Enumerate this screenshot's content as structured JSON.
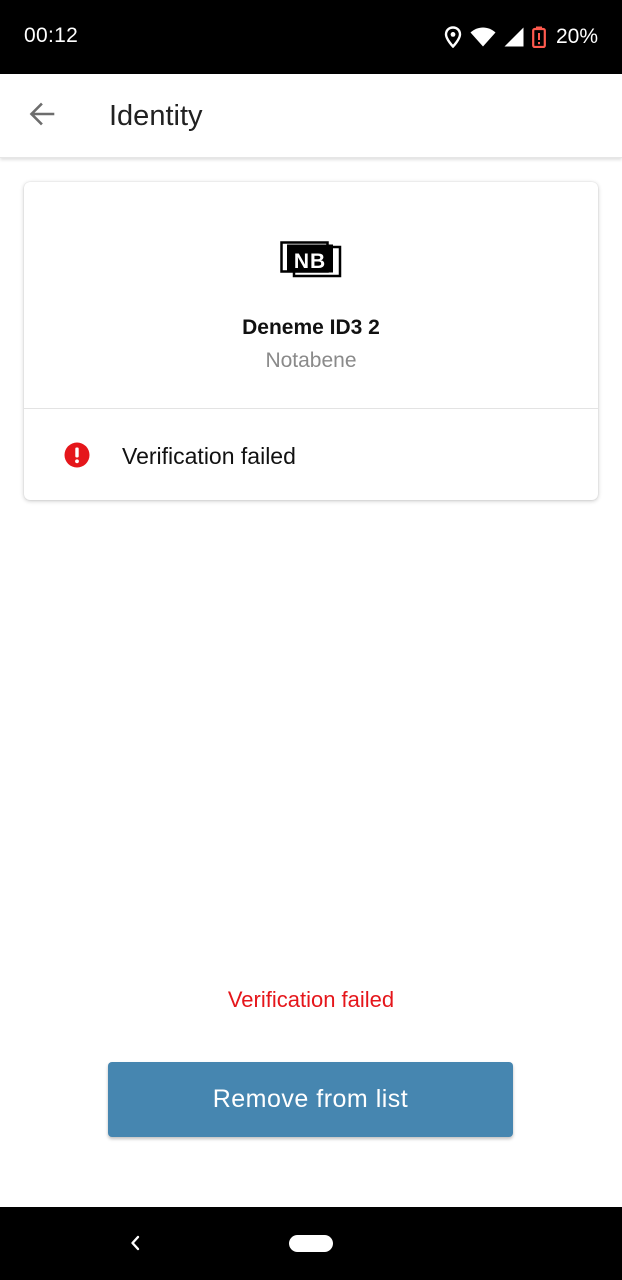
{
  "status_bar": {
    "time": "00:12",
    "battery_percent": "20%",
    "icons": [
      "location-icon",
      "wifi-icon",
      "signal-icon",
      "battery-low-icon"
    ],
    "battery_color": "#ff5a4e"
  },
  "app_bar": {
    "title": "Identity",
    "back_icon": "arrow-left-icon"
  },
  "card": {
    "logo": "NB",
    "name": "Deneme ID3 2",
    "organization": "Notabene",
    "status_text": "Verification failed",
    "status_icon": "error-icon",
    "status_color": "#e5161b"
  },
  "error_message": "Verification failed",
  "remove_button_label": "Remove from list",
  "colors": {
    "accent": "#4686b0",
    "error": "#e5161b"
  }
}
